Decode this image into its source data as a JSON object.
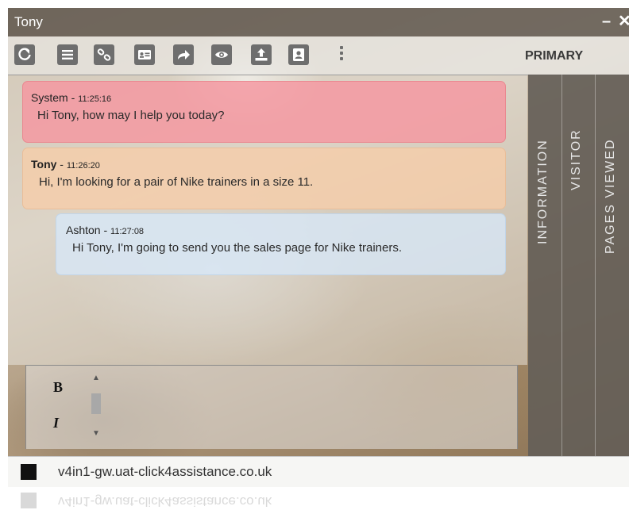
{
  "window": {
    "title": "Tony",
    "minimize_glyph": "–",
    "close_glyph": "✕"
  },
  "toolbar": {
    "buttons": [
      {
        "icon": "refresh-icon"
      },
      {
        "icon": "list-icon"
      },
      {
        "icon": "link-icon"
      },
      {
        "icon": "contact-card-icon"
      },
      {
        "icon": "forward-arrow-icon"
      },
      {
        "icon": "eye-icon"
      },
      {
        "icon": "upload-icon"
      },
      {
        "icon": "user-badge-icon"
      }
    ],
    "more_icon": "kebab-menu-icon",
    "panel_label": "PRIMARY"
  },
  "messages": [
    {
      "role": "system",
      "sender": "System",
      "separator": " - ",
      "time": "11:25:16",
      "text": "Hi Tony, how may I help you today?"
    },
    {
      "role": "customer",
      "sender": "Tony",
      "separator": " - ",
      "time": "11:26:20",
      "text": "Hi, I'm looking for a pair of Nike trainers in a size 11."
    },
    {
      "role": "agent",
      "sender": "Ashton",
      "separator": " - ",
      "time": "11:27:08",
      "text": "Hi Tony, I'm going to send you the sales page for Nike trainers."
    }
  ],
  "side_tabs": [
    "INFORMATION",
    "VISITOR",
    "PAGES VIEWED"
  ],
  "composer": {
    "bold_label": "B",
    "italic_label": "I",
    "scroll_up": "▲",
    "scroll_down": "▼"
  },
  "status": {
    "host": "v4in1-gw.uat-click4assistance.co.uk"
  },
  "colors": {
    "system_bubble": "#f596a0",
    "customer_bubble": "#f5cdaa",
    "agent_bubble": "#d7e8f8",
    "toolbar_icon": "#6e6e6e",
    "side_panel": "#645e58"
  }
}
